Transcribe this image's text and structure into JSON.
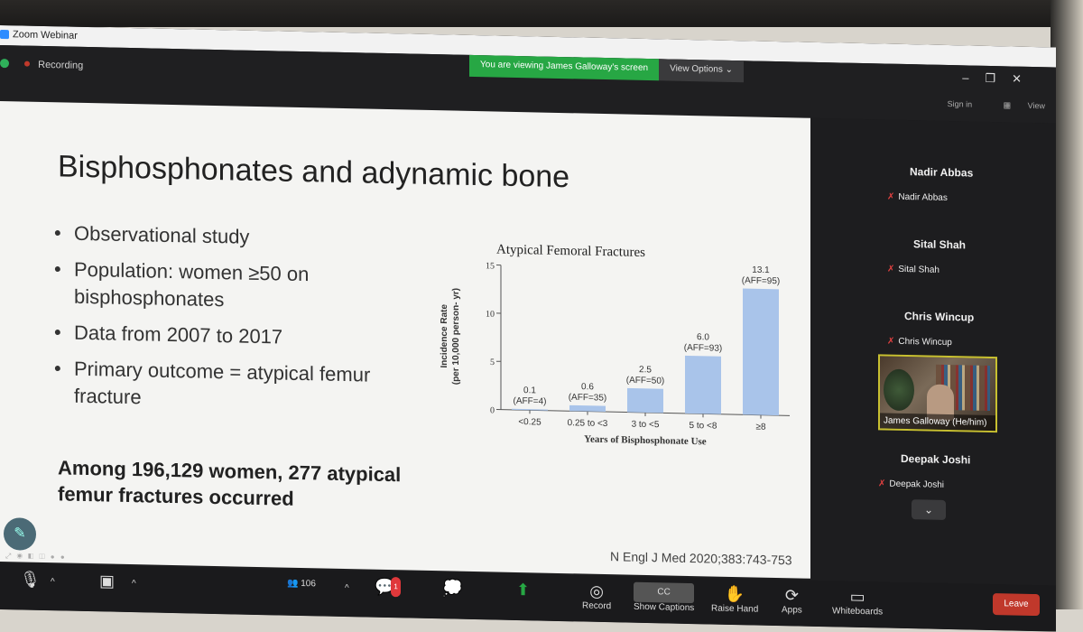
{
  "window": {
    "title": "Zoom Webinar",
    "recording_label": "Recording",
    "viewing_banner": "You are viewing James Galloway's screen",
    "view_options": "View Options",
    "sign_in": "Sign in",
    "view": "View"
  },
  "slide": {
    "title": "Bisphosphonates and adynamic bone",
    "bullets": [
      "Observational study",
      "Population: women ≥50 on bisphosphonates",
      "Data from 2007 to 2017",
      "Primary outcome = atypical femur fracture"
    ],
    "summary": "Among 196,129 women, 277 atypical femur fractures occurred",
    "citation": "N Engl J Med 2020;383:743-753"
  },
  "chart_data": {
    "type": "bar",
    "title": "Atypical Femoral Fractures",
    "xlabel": "Years of Bisphosphonate Use",
    "ylabel": "Incidence Rate (per 10,000 person- yr)",
    "categories": [
      "<0.25",
      "0.25 to <3",
      "3 to <5",
      "5 to <8",
      "≥8"
    ],
    "values": [
      0.1,
      0.6,
      2.5,
      6.0,
      13.1
    ],
    "value_labels": [
      "0.1",
      "0.6",
      "2.5",
      "6.0",
      "13.1"
    ],
    "aff_labels": [
      "(AFF=4)",
      "(AFF=35)",
      "(AFF=50)",
      "(AFF=93)",
      "(AFF=95)"
    ],
    "ylim": [
      0,
      15
    ],
    "yticks": [
      0,
      5,
      10,
      15
    ],
    "bar_color": "#a9c4ea",
    "grid": false
  },
  "participants": [
    {
      "heading": "Nadir Abbas",
      "tag": "Nadir Abbas"
    },
    {
      "heading": "Sital Shah",
      "tag": "Sital Shah"
    },
    {
      "heading": "Chris Wincup",
      "tag": "Chris Wincup"
    },
    {
      "heading": "Deepak Joshi",
      "tag": "Deepak Joshi"
    }
  ],
  "video_tile": {
    "label": "James Galloway (He/him)"
  },
  "toolbar": {
    "participants_count": "106",
    "chat_badge": "1",
    "show_captions": "Show Captions",
    "raise_hand": "Raise Hand",
    "apps": "Apps",
    "whiteboards": "Whiteboards",
    "record": "Record",
    "leave": "Leave",
    "cc": "CC"
  },
  "colors": {
    "accent": "#27a744",
    "leave": "#c0382b"
  }
}
